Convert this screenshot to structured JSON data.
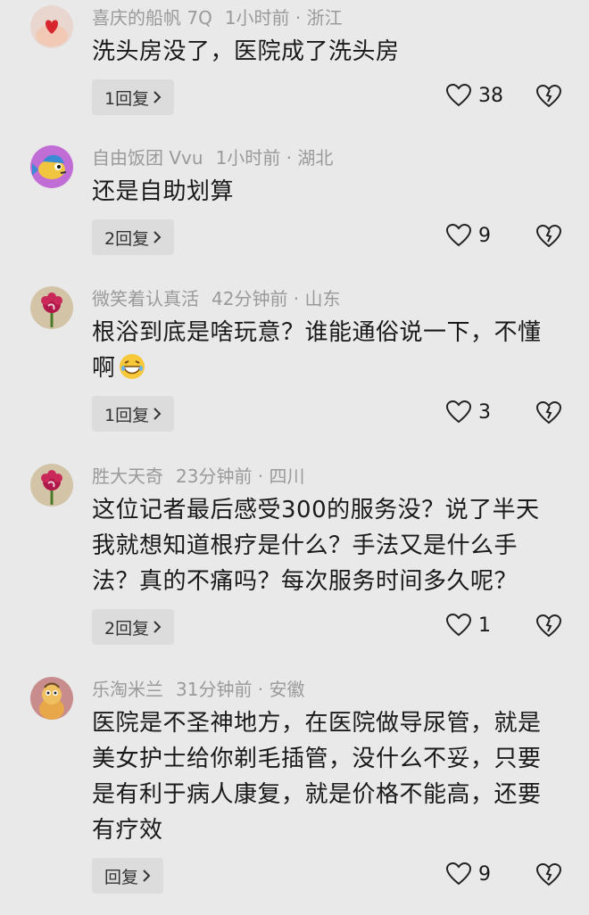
{
  "comments": [
    {
      "username": "喜庆的船帆 7Q",
      "time_location": "1小时前 · 浙江",
      "lines": [
        "洗头房没了，医院成了洗头房"
      ],
      "reply_label": "1回复",
      "likes": "38",
      "avatar": "heart-hands-avatar"
    },
    {
      "username": "自由饭团 Vvu",
      "time_location": "1小时前 · 湖北",
      "lines": [
        "还是自助划算"
      ],
      "reply_label": "2回复",
      "likes": "9",
      "avatar": "cartoon-fish-avatar"
    },
    {
      "username": "微笑着认真活",
      "time_location": "42分钟前 · 山东",
      "lines": [
        "根浴到底是啥玩意？谁能通俗说一下，不懂",
        "啊"
      ],
      "reply_label": "1回复",
      "likes": "3",
      "avatar": "flower-avatar",
      "emoji": "grinning-emoji"
    },
    {
      "username": "胜大天奇",
      "time_location": "23分钟前 · 四川",
      "lines": [
        "这位记者最后感受300的服务没？说了半天",
        "我就想知道根疗是什么？手法又是什么手",
        "法？真的不痛吗？每次服务时间多久呢？"
      ],
      "reply_label": "2回复",
      "likes": "1",
      "avatar": "flower-avatar"
    },
    {
      "username": "乐淘米兰",
      "time_location": "31分钟前 · 安徽",
      "lines": [
        "医院是不圣神地方，在医院做导尿管，就是",
        "美女护士给你剃毛插管，没什么不妥，只要",
        "是有利于病人康复，就是价格不能高，还要",
        "有疗效"
      ],
      "reply_label": "回复",
      "likes": "9",
      "avatar": "toy-figure-avatar"
    }
  ]
}
